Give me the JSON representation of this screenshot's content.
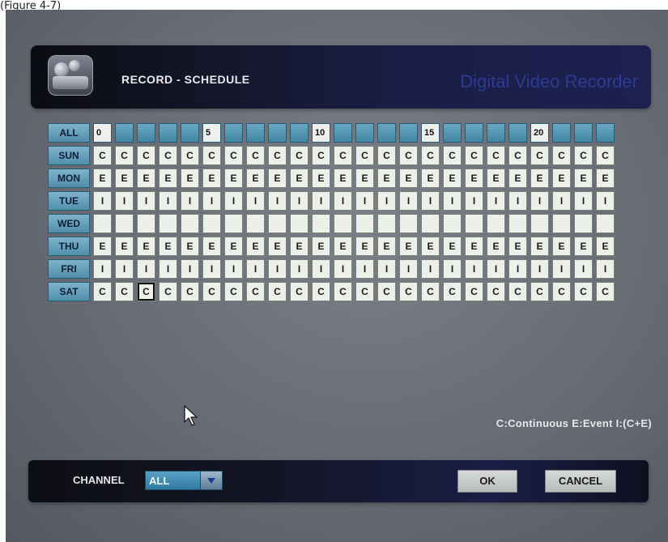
{
  "caption": "(Figure 4-7)",
  "header": {
    "title": "RECORD - SCHEDULE",
    "brand": "Digital Video Recorder",
    "icon": "camera-icon"
  },
  "schedule": {
    "corner_label": "ALL",
    "hour_numbers": [
      "0",
      "",
      "",
      "",
      "",
      "5",
      "",
      "",
      "",
      "",
      "10",
      "",
      "",
      "",
      "",
      "15",
      "",
      "",
      "",
      "",
      "20",
      "",
      "",
      ""
    ],
    "rows": [
      {
        "day": "SUN",
        "cells": [
          "C",
          "C",
          "C",
          "C",
          "C",
          "C",
          "C",
          "C",
          "C",
          "C",
          "C",
          "C",
          "C",
          "C",
          "C",
          "C",
          "C",
          "C",
          "C",
          "C",
          "C",
          "C",
          "C",
          "C"
        ]
      },
      {
        "day": "MON",
        "cells": [
          "E",
          "E",
          "E",
          "E",
          "E",
          "E",
          "E",
          "E",
          "E",
          "E",
          "E",
          "E",
          "E",
          "E",
          "E",
          "E",
          "E",
          "E",
          "E",
          "E",
          "E",
          "E",
          "E",
          "E"
        ]
      },
      {
        "day": "TUE",
        "cells": [
          "I",
          "I",
          "I",
          "I",
          "I",
          "I",
          "I",
          "I",
          "I",
          "I",
          "I",
          "I",
          "I",
          "I",
          "I",
          "I",
          "I",
          "I",
          "I",
          "I",
          "I",
          "I",
          "I",
          "I"
        ]
      },
      {
        "day": "WED",
        "cells": [
          "",
          "",
          "",
          "",
          "",
          "",
          "",
          "",
          "",
          "",
          "",
          "",
          "",
          "",
          "",
          "",
          "",
          "",
          "",
          "",
          "",
          "",
          "",
          ""
        ]
      },
      {
        "day": "THU",
        "cells": [
          "E",
          "E",
          "E",
          "E",
          "E",
          "E",
          "E",
          "E",
          "E",
          "E",
          "E",
          "E",
          "E",
          "E",
          "E",
          "E",
          "E",
          "E",
          "E",
          "E",
          "E",
          "E",
          "E",
          "E"
        ]
      },
      {
        "day": "FRI",
        "cells": [
          "I",
          "I",
          "I",
          "I",
          "I",
          "I",
          "I",
          "I",
          "I",
          "I",
          "I",
          "I",
          "I",
          "I",
          "I",
          "I",
          "I",
          "I",
          "I",
          "I",
          "I",
          "I",
          "I",
          "I"
        ]
      },
      {
        "day": "SAT",
        "cells": [
          "C",
          "C",
          "C",
          "C",
          "C",
          "C",
          "C",
          "C",
          "C",
          "C",
          "C",
          "C",
          "C",
          "C",
          "C",
          "C",
          "C",
          "C",
          "C",
          "C",
          "C",
          "C",
          "C",
          "C"
        ]
      }
    ],
    "selected": {
      "day": "SAT",
      "hour": 2
    }
  },
  "legend": "C:Continuous E:Event I:(C+E)",
  "footer": {
    "channel_label": "CHANNEL",
    "channel_value": "ALL",
    "ok_label": "OK",
    "cancel_label": "CANCEL"
  },
  "colors": {
    "header_bg": "#1a1e46",
    "day_header": "#4f8fab",
    "cell_bg": "#edefe9",
    "select_bg": "#2f7ca3",
    "brand_text": "#2f3d9a"
  }
}
